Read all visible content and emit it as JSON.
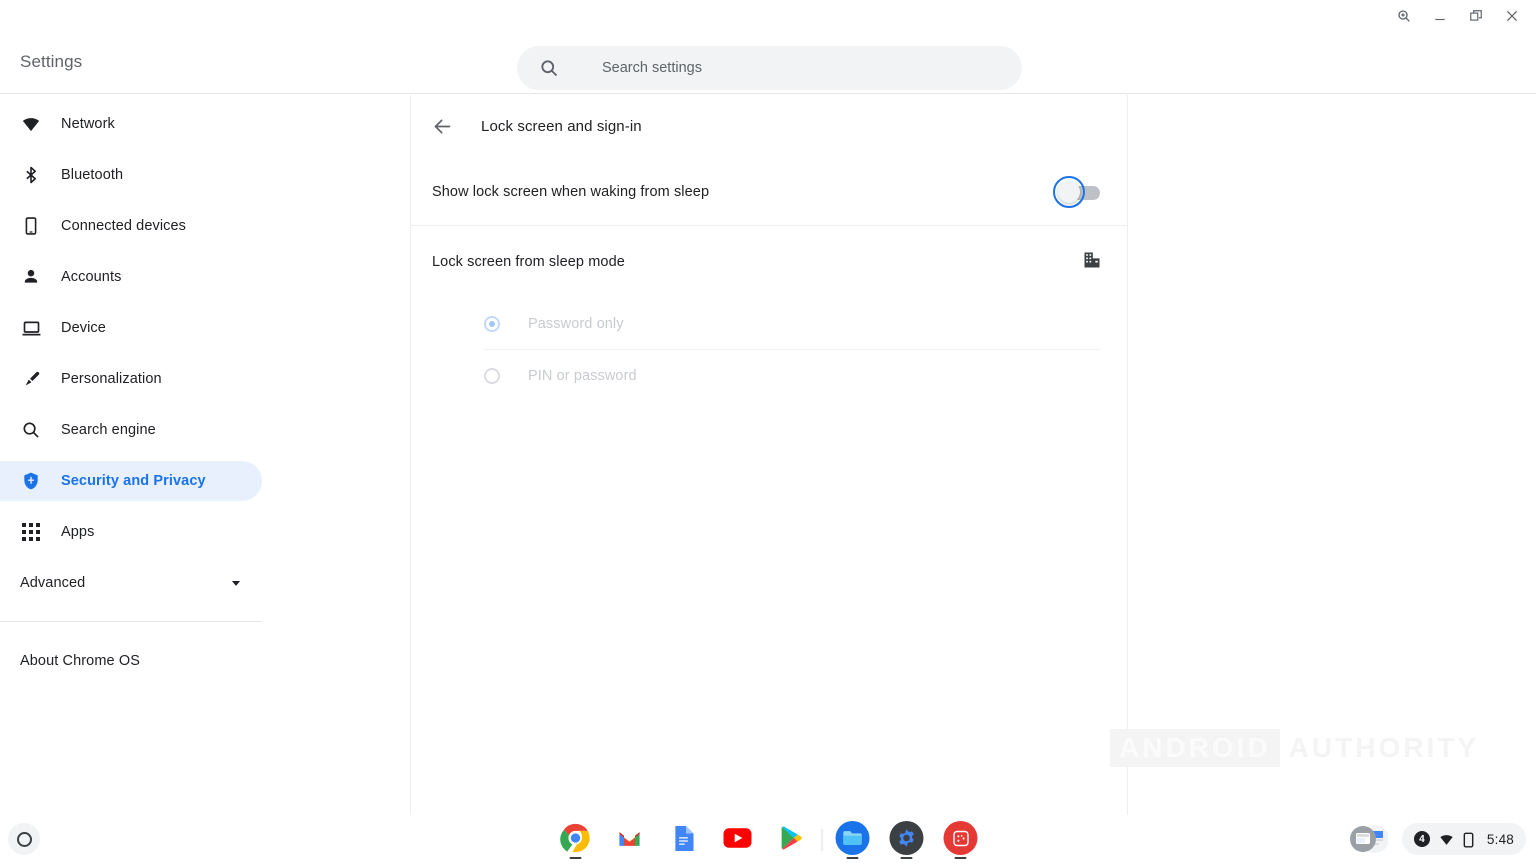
{
  "window": {
    "controls": [
      {
        "name": "zoom-search-icon",
        "label": "Search tabs"
      },
      {
        "name": "minimize-icon",
        "label": "Minimize"
      },
      {
        "name": "maximize-icon",
        "label": "Maximize"
      },
      {
        "name": "close-icon",
        "label": "Close"
      }
    ]
  },
  "header": {
    "title": "Settings"
  },
  "search": {
    "placeholder": "Search settings",
    "value": "",
    "icon": "search-icon"
  },
  "sidebar": {
    "items": [
      {
        "label": "Network",
        "icon": "wifi-icon",
        "selected": false
      },
      {
        "label": "Bluetooth",
        "icon": "bluetooth-icon",
        "selected": false
      },
      {
        "label": "Connected devices",
        "icon": "phone-icon",
        "selected": false
      },
      {
        "label": "Accounts",
        "icon": "person-icon",
        "selected": false
      },
      {
        "label": "Device",
        "icon": "laptop-icon",
        "selected": false
      },
      {
        "label": "Personalization",
        "icon": "paintbrush-icon",
        "selected": false
      },
      {
        "label": "Search engine",
        "icon": "magnifier-icon",
        "selected": false
      },
      {
        "label": "Security and Privacy",
        "icon": "shield-icon",
        "selected": true
      },
      {
        "label": "Apps",
        "icon": "grid-apps-icon",
        "selected": false
      }
    ],
    "advanced": {
      "label": "Advanced",
      "icon": "chevron-down-icon"
    },
    "about": {
      "label": "About Chrome OS"
    }
  },
  "main": {
    "back_icon": "back-arrow-icon",
    "title": "Lock screen and sign-in",
    "toggle_row": {
      "label": "Show lock screen when waking from sleep",
      "state": "off",
      "focused": true
    },
    "section": {
      "title": "Lock screen from sleep mode",
      "managed_icon": "enterprise-building-icon",
      "options": [
        {
          "label": "Password only",
          "checked": true,
          "disabled": true
        },
        {
          "label": "PIN or password",
          "checked": false,
          "disabled": true
        }
      ]
    }
  },
  "watermark": {
    "boxed": "ANDROID",
    "plain": "AUTHORITY"
  },
  "shelf": {
    "launcher": {
      "icon": "launcher-circle-icon",
      "label": "Launcher"
    },
    "apps": [
      {
        "label": "Chrome",
        "icon": "chrome-icon",
        "running": true
      },
      {
        "label": "Gmail",
        "icon": "gmail-icon",
        "running": false
      },
      {
        "label": "Docs",
        "icon": "docs-icon",
        "running": false
      },
      {
        "label": "YouTube",
        "icon": "youtube-icon",
        "running": false
      },
      {
        "label": "Play Store",
        "icon": "play-store-icon",
        "running": false
      },
      {
        "label": "Files",
        "icon": "files-icon",
        "running": true
      },
      {
        "label": "Settings",
        "icon": "settings-gear-icon",
        "running": true
      },
      {
        "label": "Dice",
        "icon": "dice-app-icon",
        "running": true
      }
    ],
    "tray": {
      "notification_count": "4",
      "wifi_icon": "wifi-icon",
      "battery_icon": "battery-icon",
      "time": "5:48"
    }
  },
  "colors": {
    "accent": "#1a73e8",
    "selected_pill": "#e8f0fe",
    "text_primary": "#202124",
    "text_secondary": "#5f6368",
    "disabled_text": "#c8cbcf"
  }
}
